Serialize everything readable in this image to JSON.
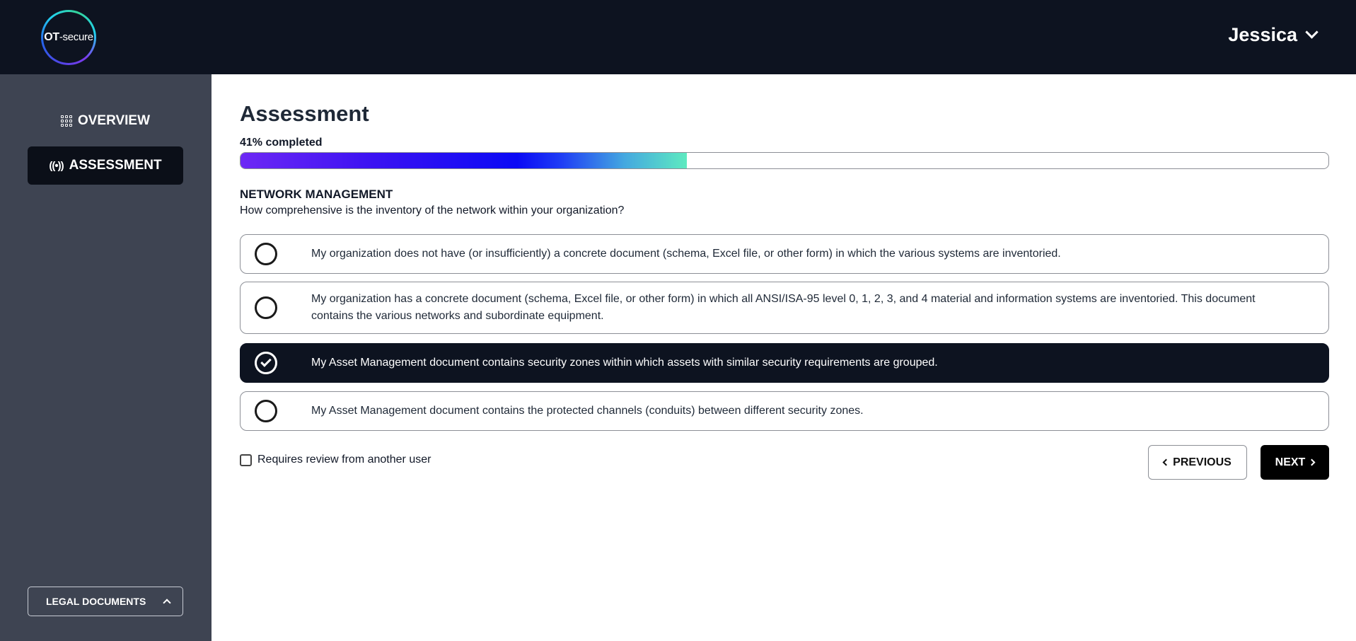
{
  "header": {
    "logo_bold": "OT",
    "logo_text": "-secure",
    "user_name": "Jessica"
  },
  "sidebar": {
    "items": [
      {
        "label": "OVERVIEW",
        "icon": "grid-icon"
      },
      {
        "label": "ASSESSMENT",
        "icon": "broadcast-icon",
        "active": true
      }
    ],
    "legal_label": "LEGAL DOCUMENTS"
  },
  "main": {
    "title": "Assessment",
    "progress": {
      "label": "41% completed",
      "percent": 41
    },
    "section_title": "NETWORK MANAGEMENT",
    "question": "How comprehensive is the inventory of the network within your organization?",
    "options": [
      {
        "text": "My organization does not have (or insufficiently) a concrete document (schema, Excel file, or other form) in which the various systems are inventoried.",
        "selected": false
      },
      {
        "text": "My organization has a concrete document (schema, Excel file, or other form) in which all ANSI/ISA-95 level 0, 1, 2, 3, and 4 material and information systems are inventoried. This document contains the various networks and subordinate equipment.",
        "selected": false
      },
      {
        "text": "My Asset Management document contains security zones within which assets with similar security requirements are grouped.",
        "selected": true
      },
      {
        "text": "My Asset Management document contains the protected channels (conduits) between different security zones.",
        "selected": false
      }
    ],
    "review_label": "Requires review from another user",
    "prev_label": "PREVIOUS",
    "next_label": "NEXT"
  },
  "colors": {
    "header_bg": "#0d1320",
    "sidebar_bg": "#3e4452",
    "selected_bg": "#0d1320",
    "progress_start": "#6d28f5",
    "progress_end": "#5eeac0"
  }
}
